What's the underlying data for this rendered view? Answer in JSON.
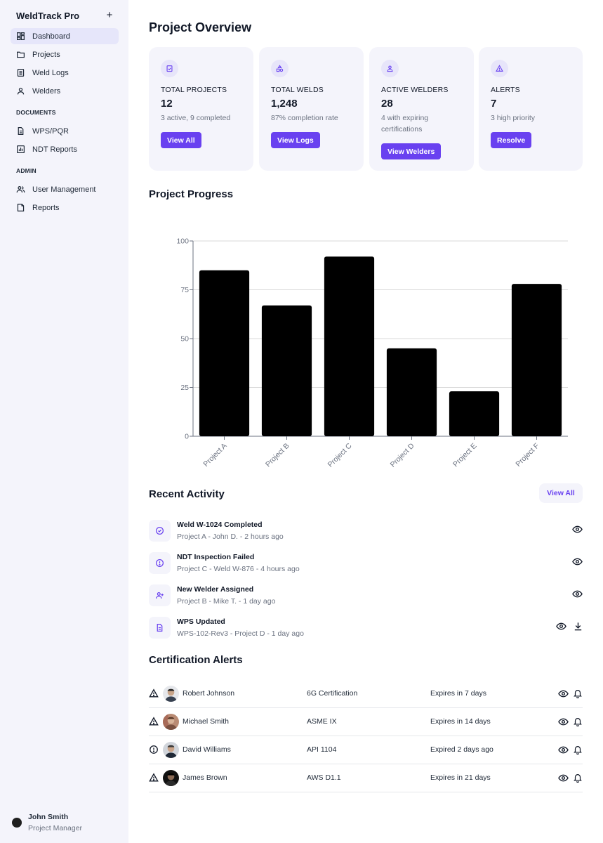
{
  "app": {
    "title": "WeldTrack Pro"
  },
  "sidebar": {
    "main_items": [
      {
        "label": "Dashboard",
        "icon": "dashboard-icon",
        "active": true
      },
      {
        "label": "Projects",
        "icon": "folder-icon"
      },
      {
        "label": "Weld Logs",
        "icon": "clipboard-icon"
      },
      {
        "label": "Welders",
        "icon": "user-icon"
      }
    ],
    "documents_heading": "DOCUMENTS",
    "documents_items": [
      {
        "label": "WPS/PQR",
        "icon": "document-icon"
      },
      {
        "label": "NDT Reports",
        "icon": "report-chart-icon"
      }
    ],
    "admin_heading": "ADMIN",
    "admin_items": [
      {
        "label": "User Management",
        "icon": "users-icon"
      },
      {
        "label": "Reports",
        "icon": "report-icon"
      }
    ],
    "user": {
      "name": "John Smith",
      "role": "Project Manager"
    }
  },
  "overview": {
    "title": "Project Overview",
    "cards": [
      {
        "label": "TOTAL PROJECTS",
        "value": "12",
        "sub": "3 active, 9 completed",
        "button": "View All"
      },
      {
        "label": "TOTAL WELDS",
        "value": "1,248",
        "sub": "87% completion rate",
        "button": "View Logs"
      },
      {
        "label": "ACTIVE WELDERS",
        "value": "28",
        "sub": "4 with expiring certifications",
        "button": "View Welders"
      },
      {
        "label": "ALERTS",
        "value": "7",
        "sub": "3 high priority",
        "button": "Resolve"
      }
    ]
  },
  "progress": {
    "title": "Project Progress"
  },
  "chart_data": {
    "type": "bar",
    "categories": [
      "Project A",
      "Project B",
      "Project C",
      "Project D",
      "Project E",
      "Project F"
    ],
    "values": [
      85,
      67,
      92,
      45,
      23,
      78
    ],
    "ylim": [
      0,
      100
    ],
    "yticks": [
      "0",
      "25",
      "50",
      "75",
      "100"
    ],
    "grid": true,
    "bar_color": "#000000"
  },
  "activity": {
    "title": "Recent Activity",
    "view_all": "View All",
    "items": [
      {
        "title": "Weld W-1024 Completed",
        "sub": "Project A - John D. - 2 hours ago",
        "icon": "check-circle-icon"
      },
      {
        "title": "NDT Inspection Failed",
        "sub": "Project C - Weld W-876 - 4 hours ago",
        "icon": "alert-circle-icon"
      },
      {
        "title": "New Welder Assigned",
        "sub": "Project B - Mike T. - 1 day ago",
        "icon": "user-plus-icon"
      },
      {
        "title": "WPS Updated",
        "sub": "WPS-102-Rev3 - Project D - 1 day ago",
        "icon": "document-icon"
      }
    ]
  },
  "certifications": {
    "title": "Certification Alerts",
    "rows": [
      {
        "name": "Robert Johnson",
        "cert": "6G Certification",
        "expires": "Expires in 7 days",
        "status_icon": "warning-triangle-icon"
      },
      {
        "name": "Michael Smith",
        "cert": "ASME IX",
        "expires": "Expires in 14 days",
        "status_icon": "warning-triangle-icon"
      },
      {
        "name": "David Williams",
        "cert": "API 1104",
        "expires": "Expired 2 days ago",
        "status_icon": "alert-circle-icon"
      },
      {
        "name": "James Brown",
        "cert": "AWS D1.1",
        "expires": "Expires in 21 days",
        "status_icon": "warning-triangle-icon"
      }
    ]
  },
  "colors": {
    "accent": "#6941f0",
    "sidebar_bg": "#f4f4fb",
    "card_bg": "#f4f4fb",
    "active_nav": "#e6e6fa"
  }
}
